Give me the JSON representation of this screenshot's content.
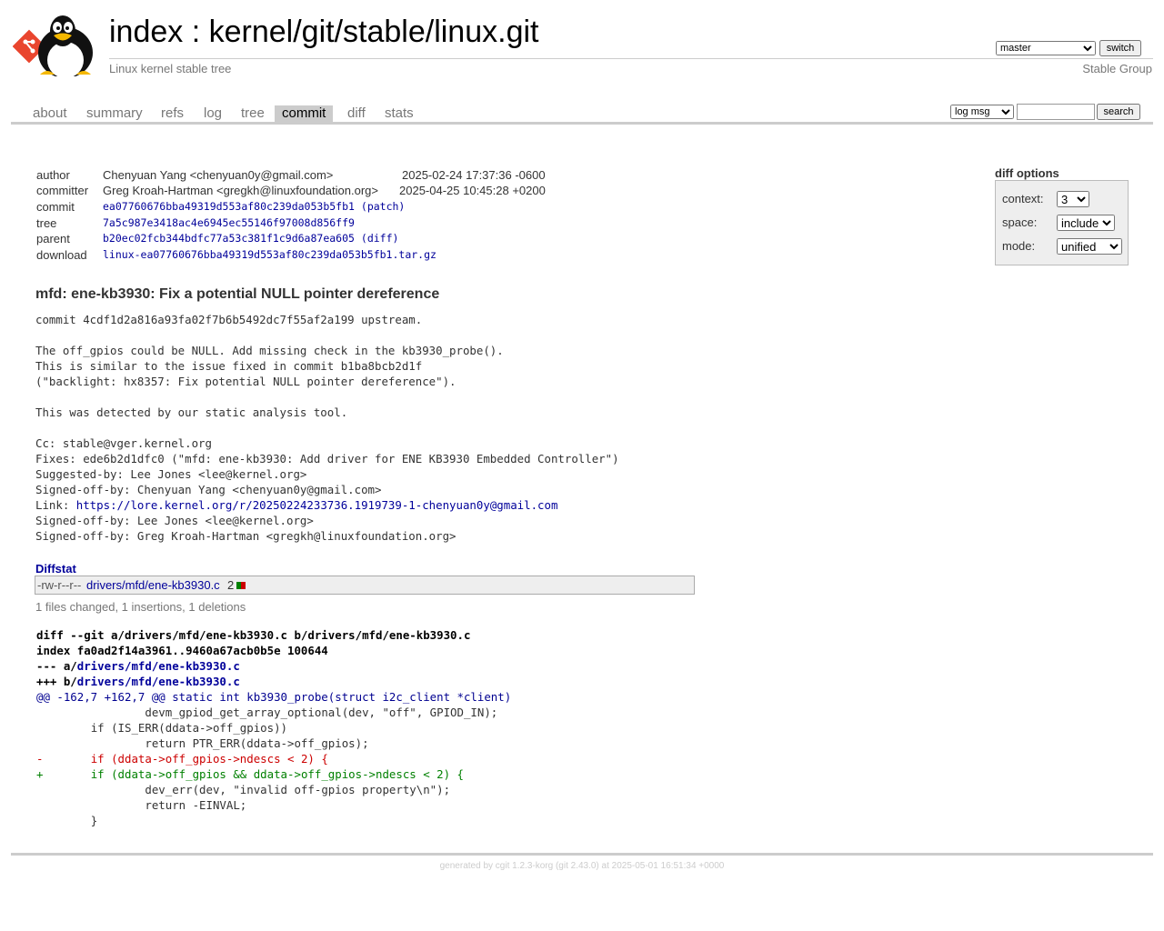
{
  "header": {
    "title_prefix": "index",
    "title_sep": " : ",
    "repo": "kernel/git/stable/linux.git",
    "subtitle": "Linux kernel stable tree",
    "owner": "Stable Group",
    "branch": "master",
    "switch_label": "switch"
  },
  "tabs": [
    {
      "label": "about"
    },
    {
      "label": "summary"
    },
    {
      "label": "refs"
    },
    {
      "label": "log"
    },
    {
      "label": "tree"
    },
    {
      "label": "commit"
    },
    {
      "label": "diff"
    },
    {
      "label": "stats"
    }
  ],
  "search": {
    "grep_option": "log msg",
    "query": "",
    "button_label": "search"
  },
  "info": {
    "author_label": "author",
    "author": "Chenyuan Yang <chenyuan0y@gmail.com>",
    "author_date": "2025-02-24 17:37:36 -0600",
    "committer_label": "committer",
    "committer": "Greg Kroah-Hartman <gregkh@linuxfoundation.org>",
    "committer_date": "2025-04-25 10:45:28 +0200",
    "commit_label": "commit",
    "commit": "ea07760676bba49319d553af80c239da053b5fb1",
    "commit_patch": "(patch)",
    "tree_label": "tree",
    "tree": "7a5c987e3418ac4e6945ec55146f97008d856ff9",
    "parent_label": "parent",
    "parent": "b20ec02fcb344bdfc77a53c381f1c9d6a87ea605",
    "parent_diff": "(diff)",
    "download_label": "download",
    "download": "linux-ea07760676bba49319d553af80c239da053b5fb1.tar.gz"
  },
  "diff_options": {
    "title": "diff options",
    "context_label": "context:",
    "context_value": "3",
    "space_label": "space:",
    "space_value": "include",
    "mode_label": "mode:",
    "mode_value": "unified"
  },
  "subject": "mfd: ene-kb3930: Fix a potential NULL pointer dereference",
  "message": {
    "before_link": "commit 4cdf1d2a816a93fa02f7b6b5492dc7f55af2a199 upstream.\n\nThe off_gpios could be NULL. Add missing check in the kb3930_probe().\nThis is similar to the issue fixed in commit b1ba8bcb2d1f\n(\"backlight: hx8357: Fix potential NULL pointer dereference\").\n\nThis was detected by our static analysis tool.\n\nCc: stable@vger.kernel.org\nFixes: ede6b2d1dfc0 (\"mfd: ene-kb3930: Add driver for ENE KB3930 Embedded Controller\")\nSuggested-by: Lee Jones <lee@kernel.org>\nSigned-off-by: Chenyuan Yang <chenyuan0y@gmail.com>\nLink: ",
    "link": "https://lore.kernel.org/r/20250224233736.1919739-1-chenyuan0y@gmail.com",
    "after_link": "\nSigned-off-by: Lee Jones <lee@kernel.org>\nSigned-off-by: Greg Kroah-Hartman <gregkh@linuxfoundation.org>"
  },
  "diffstat": {
    "header": "Diffstat",
    "mode": "-rw-r--r--",
    "file": "drivers/mfd/ene-kb3930.c",
    "count": "2",
    "insertions": 1,
    "deletions": 1,
    "summary": "1 files changed, 1 insertions, 1 deletions"
  },
  "diff": {
    "header_line": "diff --git a/drivers/mfd/ene-kb3930.c b/drivers/mfd/ene-kb3930.c",
    "index_line": "index fa0ad2f14a3961..9460a67acb0b5e 100644",
    "minus_prefix": "--- a/",
    "minus_file": "drivers/mfd/ene-kb3930.c",
    "plus_prefix": "+++ b/",
    "plus_file": "drivers/mfd/ene-kb3930.c",
    "hunk": "@@ -162,7 +162,7 @@ static int kb3930_probe(struct i2c_client *client)",
    "lines": [
      {
        "type": "ctx",
        "text": " \t\tdevm_gpiod_get_array_optional(dev, \"off\", GPIOD_IN);"
      },
      {
        "type": "ctx",
        "text": " \tif (IS_ERR(ddata->off_gpios))"
      },
      {
        "type": "ctx",
        "text": " \t\treturn PTR_ERR(ddata->off_gpios);"
      },
      {
        "type": "del",
        "text": "-\tif (ddata->off_gpios->ndescs < 2) {"
      },
      {
        "type": "add",
        "text": "+\tif (ddata->off_gpios && ddata->off_gpios->ndescs < 2) {"
      },
      {
        "type": "ctx",
        "text": " \t\tdev_err(dev, \"invalid off-gpios property\\n\");"
      },
      {
        "type": "ctx",
        "text": " \t\treturn -EINVAL;"
      },
      {
        "type": "ctx",
        "text": " \t}"
      }
    ]
  },
  "footer": {
    "prefix": "generated by ",
    "cgit": "cgit 1.2.3-korg",
    "rest": " (git 2.43.0) at 2025-05-01 16:51:34 +0000"
  },
  "colors": {
    "accent_link": "#00009a",
    "insert": "#008000",
    "delete": "#cc0000",
    "tab_active_bg": "#cccccc"
  }
}
